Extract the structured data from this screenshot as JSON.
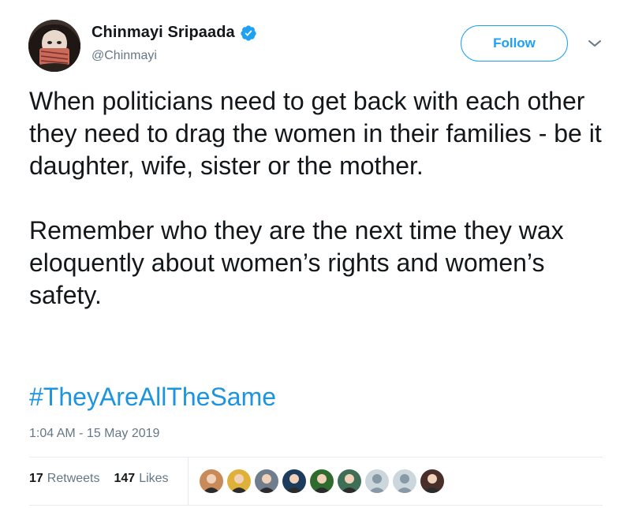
{
  "author": {
    "display_name": "Chinmayi Sripaada",
    "handle": "@Chinmayi",
    "verified": true,
    "avatar_icon": "profile-photo-avatar"
  },
  "follow_button": {
    "label": "Follow"
  },
  "menu_icon": "chevron-down-icon",
  "tweet": {
    "paragraphs": [
      "When politicians need to get back with each other they need to drag the women in their families - be it daughter, wife, sister or the mother.",
      "Remember who they are the next time they wax eloquently about women’s rights and women’s safety."
    ],
    "hashtag": "#TheyAreAllTheSame",
    "timestamp": "1:04 AM - 15 May 2019"
  },
  "stats": {
    "retweets_count": "17",
    "retweets_label": "Retweets",
    "likes_count": "147",
    "likes_label": "Likes"
  },
  "likers": [
    {
      "kind": "photo",
      "color": "#c98a5a"
    },
    {
      "kind": "photo",
      "color": "#e0b13a"
    },
    {
      "kind": "photo",
      "color": "#6f7d8c"
    },
    {
      "kind": "photo",
      "color": "#1d3b5c"
    },
    {
      "kind": "photo",
      "color": "#2f6b2f"
    },
    {
      "kind": "photo",
      "color": "#3e6e55"
    },
    {
      "kind": "default",
      "color": "#ccd6dd"
    },
    {
      "kind": "default",
      "color": "#ccd6dd"
    },
    {
      "kind": "photo",
      "color": "#4a2e2a"
    }
  ],
  "colors": {
    "link": "#1b95e0",
    "accent": "#1da1f2",
    "muted": "#657786",
    "text": "#14171a",
    "divider": "#e6ecf0"
  }
}
